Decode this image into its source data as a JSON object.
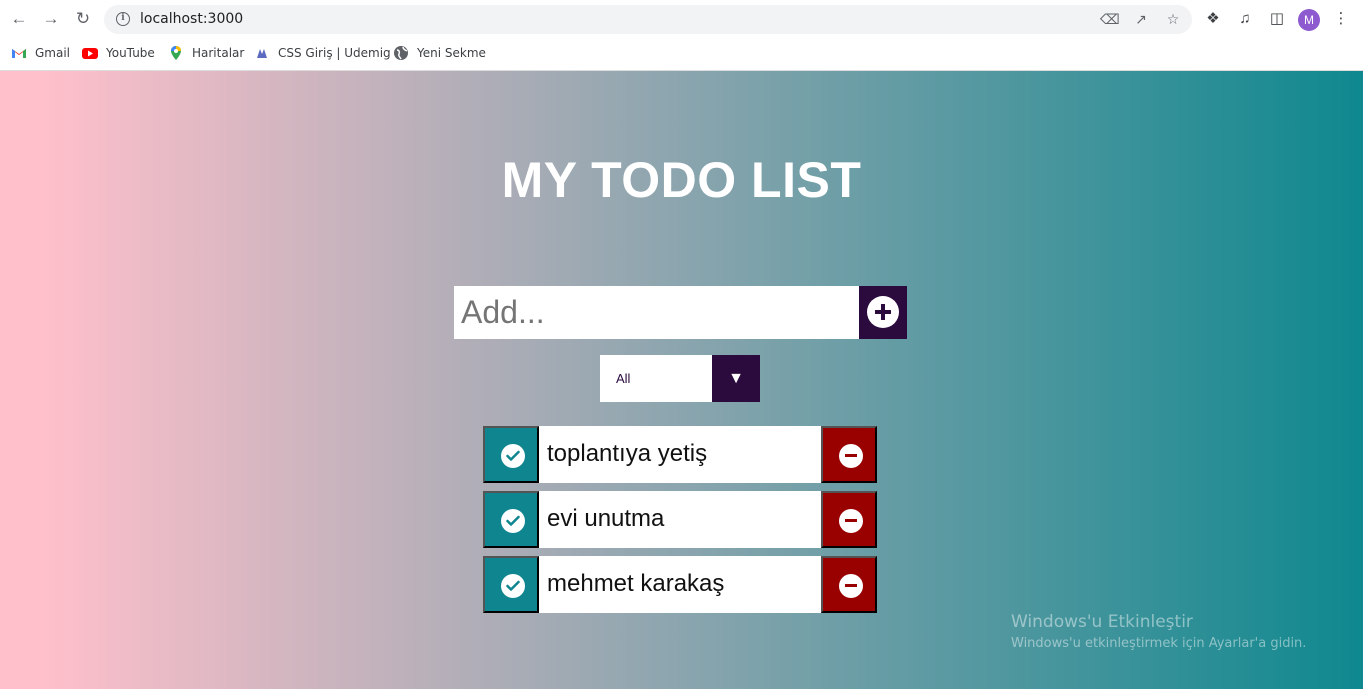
{
  "browser": {
    "url": "localhost:3000",
    "icons": {
      "back": "arrow-back-icon",
      "forward": "arrow-forward-icon",
      "reload": "reload-icon",
      "info": "info-icon",
      "translate": "translate-icon",
      "share": "share-icon",
      "bookmark": "star-icon",
      "extensions": "puzzle-icon",
      "media": "media-queue-icon",
      "sidepanel": "side-panel-icon",
      "menu": "kebab-menu-icon"
    },
    "avatar_letter": "M",
    "avatar_color": "#8e5ad0",
    "bookmarks": [
      {
        "label": "Gmail",
        "icon": "gmail-icon"
      },
      {
        "label": "YouTube",
        "icon": "youtube-icon"
      },
      {
        "label": "Haritalar",
        "icon": "maps-icon"
      },
      {
        "label": "CSS Giriş | Udemig",
        "icon": "udemig-icon"
      },
      {
        "label": "Yeni Sekme",
        "icon": "globe-icon"
      }
    ]
  },
  "app": {
    "title": "MY TODO LIST",
    "add_placeholder": "Add...",
    "filter_selected": "All",
    "colors": {
      "accent_dark": "#2b0a3d",
      "check_teal": "#0f868f",
      "delete_red": "#990000",
      "gradient_start": "#ffc0cb",
      "gradient_end": "#0f888f"
    },
    "todos": [
      {
        "text": "toplantıya yetiş"
      },
      {
        "text": "evi unutma"
      },
      {
        "text": "mehmet karakaş"
      }
    ]
  },
  "watermark": {
    "title": "Windows'u Etkinleştir",
    "subtitle": "Windows'u etkinleştirmek için Ayarlar'a gidin."
  }
}
